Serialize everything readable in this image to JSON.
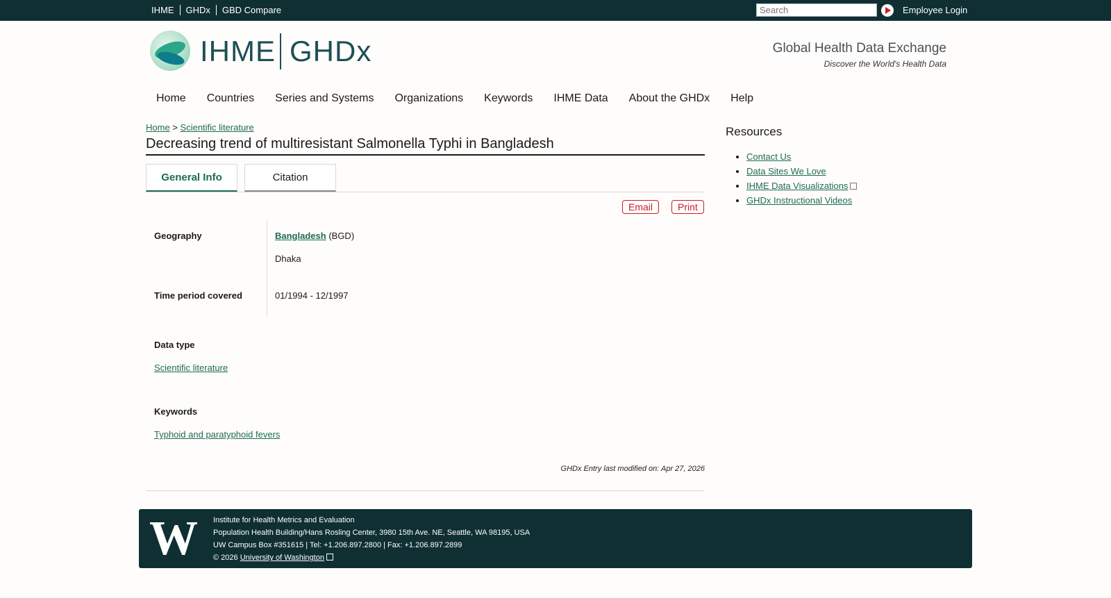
{
  "topbar": {
    "links": [
      "IHME",
      "GHDx",
      "GBD Compare"
    ],
    "search_placeholder": "Search",
    "login": "Employee Login"
  },
  "header": {
    "brand_left": "IHME",
    "brand_right": "GHDx",
    "tagline_title": "Global Health Data Exchange",
    "tagline_sub": "Discover the World's Health Data"
  },
  "nav": [
    "Home",
    "Countries",
    "Series and Systems",
    "Organizations",
    "Keywords",
    "IHME Data",
    "About the GHDx",
    "Help"
  ],
  "breadcrumb": {
    "home": "Home",
    "sep": ">",
    "current": "Scientific literature"
  },
  "page_title": "Decreasing trend of multiresistant Salmonella Typhi in Bangladesh",
  "tabs": [
    "General Info",
    "Citation"
  ],
  "actions": {
    "email": "Email",
    "print": "Print"
  },
  "fields": {
    "geography_label": "Geography",
    "geography_country": "Bangladesh",
    "geography_code": "(BGD)",
    "geography_city": "Dhaka",
    "time_label": "Time period covered",
    "time_value": "01/1994 - 12/1997",
    "datatype_label": "Data type",
    "datatype_value": "Scientific literature",
    "keywords_label": "Keywords",
    "keywords_value": "Typhoid and paratyphoid fevers"
  },
  "modified": "GHDx Entry last modified on: Apr 27, 2026",
  "resources": {
    "title": "Resources",
    "items": [
      "Contact Us",
      "Data Sites We Love",
      "IHME Data Visualizations",
      "GHDx Instructional Videos"
    ]
  },
  "footer": {
    "logo": "W",
    "line1": "Institute for Health Metrics and Evaluation",
    "line2": "Population Health Building/Hans Rosling Center, 3980 15th Ave. NE, Seattle, WA 98195, USA",
    "line3": "UW Campus Box #351615 | Tel: +1.206.897.2800 | Fax: +1.206.897.2899",
    "copyright": "© 2026",
    "uw_link": "University of Washington"
  },
  "colors": {
    "topbar": "#0f2f33",
    "link": "#1e6b52",
    "accent_red": "#c81e1e"
  }
}
